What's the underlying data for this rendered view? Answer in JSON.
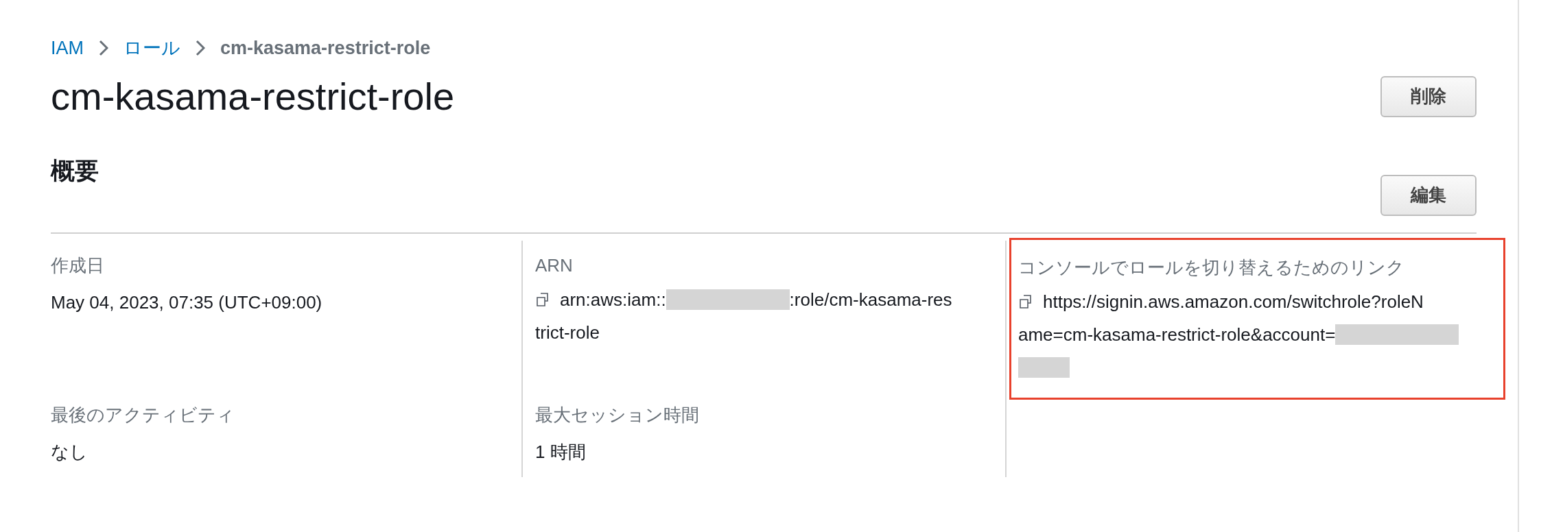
{
  "breadcrumb": [
    {
      "label": "IAM",
      "kind": "link"
    },
    {
      "label": "ロール",
      "kind": "link"
    },
    {
      "label": "cm-kasama-restrict-role",
      "kind": "current"
    }
  ],
  "title": "cm-kasama-restrict-role",
  "delete_button": "削除",
  "section": {
    "title": "概要",
    "edit_button": "編集"
  },
  "columns": [
    {
      "fields": [
        {
          "label": "作成日",
          "kind": "text",
          "value": "May 04, 2023, 07:35 (UTC+09:00)",
          "highlighted": false
        },
        {
          "label": "最後のアクティビティ",
          "kind": "text",
          "value": "なし",
          "highlighted": false
        }
      ]
    },
    {
      "fields": [
        {
          "label": "ARN",
          "kind": "copy",
          "lines": [
            {
              "parts": [
                {
                  "kind": "text",
                  "text": "arn:aws:iam::"
                },
                {
                  "kind": "redacted"
                },
                {
                  "kind": "text",
                  "text": ":role/cm-kasama-res"
                }
              ]
            },
            {
              "parts": [
                {
                  "kind": "text",
                  "text": "trict-role"
                }
              ]
            }
          ],
          "highlighted": false
        },
        {
          "label": "最大セッション時間",
          "kind": "text",
          "value": "1 時間",
          "highlighted": false
        }
      ]
    },
    {
      "fields": [
        {
          "label": "コンソールでロールを切り替えるためのリンク",
          "kind": "copy",
          "lines": [
            {
              "parts": [
                {
                  "kind": "text",
                  "text": "https://signin.aws.amazon.com/switchrole?roleN"
                }
              ]
            },
            {
              "parts": [
                {
                  "kind": "text",
                  "text": "ame=cm-kasama-restrict-role&account="
                },
                {
                  "kind": "redacted"
                }
              ]
            },
            {
              "parts": [
                {
                  "kind": "redacted"
                }
              ]
            }
          ],
          "highlighted": true
        }
      ]
    }
  ]
}
